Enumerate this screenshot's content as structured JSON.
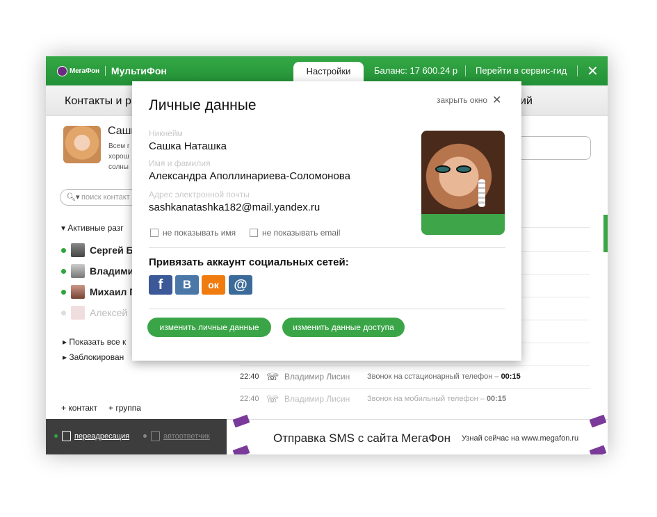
{
  "topbar": {
    "logo_text": "МегаФон",
    "product": "МультиФон",
    "tab_active": "Настройки",
    "balance": "Баланс: 17 600.24 р",
    "service_link": "Перейти в сервис-гид",
    "close_glyph": "✕"
  },
  "subheader": {
    "left": "Контакты и р",
    "right": "ий"
  },
  "profile": {
    "name": "Сашк",
    "status": "Всем г хорош солны"
  },
  "search": {
    "placeholder": "поиск контакт"
  },
  "contacts": {
    "section": "Активные разг",
    "items": [
      {
        "name": "Сергей Б",
        "online": true
      },
      {
        "name": "Владими",
        "online": true
      },
      {
        "name": "Михаил Г",
        "online": true
      },
      {
        "name": "Алексей",
        "online": false
      }
    ],
    "show_all": "Показать все к",
    "blocked": "Заблокирован",
    "add_contact": "+ контакт",
    "add_group": "+ группа"
  },
  "bottom_bar": {
    "forwarding": "переадресация",
    "autoresponder": "автоответчик",
    "colors": {
      "on": "#2fa53c",
      "off": "#888888"
    }
  },
  "calls": [
    {
      "time": "22:40",
      "who": "Владимир Лисин",
      "what": "Звонок на сстационарный телефон –",
      "duration": "00:15"
    },
    {
      "time": "22:40",
      "who": "Владимир Лисин",
      "what": "Звонок на мобильный телефон –",
      "duration": "00:15"
    }
  ],
  "banner": {
    "title": "Отправка SMS с сайта МегаФон",
    "subtitle": "Узнай сейчас на www.megafon.ru"
  },
  "modal": {
    "title": "Личные данные",
    "close": "закрыть окно",
    "nickname_label": "Никнейм",
    "nickname": "Сашка Наташка",
    "fullname_label": "Имя и фамилия",
    "fullname": "Александра Аполлинариева-Соломонова",
    "email_label": "Адрес электронной почты",
    "email": "sashkanatashka182@mail.yandex.ru",
    "hide_name": "не показывать имя",
    "hide_email": "не показывать email",
    "social_title": "Привязать аккаунт социальных сетей:",
    "social": [
      {
        "name": "facebook",
        "glyph": "f",
        "color": "#3b5998"
      },
      {
        "name": "vkontakte",
        "glyph": "B",
        "color": "#4a76a8"
      },
      {
        "name": "odnoklassniki",
        "glyph": "ок",
        "color": "#f07c10"
      },
      {
        "name": "mail",
        "glyph": "@",
        "color": "#3c6b99"
      }
    ],
    "btn_personal": "изменить личные данные",
    "btn_access": "изменить данные доступа"
  }
}
